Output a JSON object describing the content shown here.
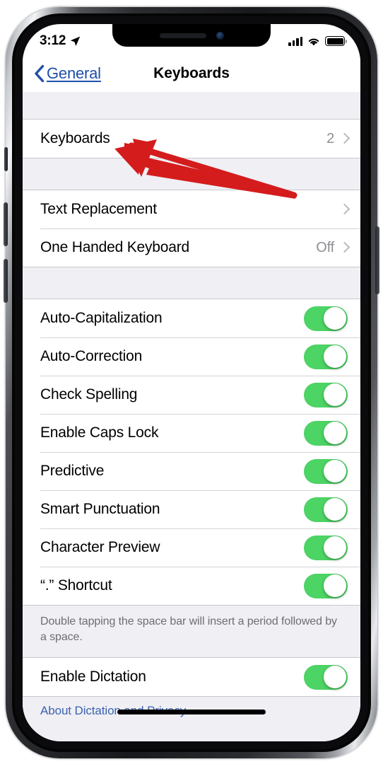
{
  "status_bar": {
    "time": "3:12",
    "location_icon": "location-arrow-icon",
    "signal_icon": "cellular-signal-icon",
    "signal_bars": 4,
    "wifi_icon": "wifi-icon",
    "battery_icon": "battery-full-icon"
  },
  "nav": {
    "back_label": "General",
    "back_icon": "chevron-left-icon",
    "title": "Keyboards"
  },
  "groups": [
    {
      "rows": [
        {
          "label": "Keyboards",
          "value": "2",
          "type": "disclosure",
          "name": "row-keyboards"
        }
      ]
    },
    {
      "rows": [
        {
          "label": "Text Replacement",
          "value": "",
          "type": "disclosure",
          "name": "row-text-replacement"
        },
        {
          "label": "One Handed Keyboard",
          "value": "Off",
          "type": "disclosure",
          "name": "row-one-handed-keyboard"
        }
      ]
    },
    {
      "rows": [
        {
          "label": "Auto-Capitalization",
          "type": "toggle",
          "state": "on",
          "name": "row-auto-capitalization"
        },
        {
          "label": "Auto-Correction",
          "type": "toggle",
          "state": "on",
          "name": "row-auto-correction"
        },
        {
          "label": "Check Spelling",
          "type": "toggle",
          "state": "on",
          "name": "row-check-spelling"
        },
        {
          "label": "Enable Caps Lock",
          "type": "toggle",
          "state": "on",
          "name": "row-enable-caps-lock"
        },
        {
          "label": "Predictive",
          "type": "toggle",
          "state": "on",
          "name": "row-predictive"
        },
        {
          "label": "Smart Punctuation",
          "type": "toggle",
          "state": "on",
          "name": "row-smart-punctuation"
        },
        {
          "label": "Character Preview",
          "type": "toggle",
          "state": "on",
          "name": "row-character-preview"
        },
        {
          "label": "“.” Shortcut",
          "type": "toggle",
          "state": "on",
          "name": "row-period-shortcut"
        }
      ]
    },
    {
      "rows": [
        {
          "label": "Enable Dictation",
          "type": "toggle",
          "state": "on",
          "name": "row-enable-dictation"
        }
      ]
    }
  ],
  "footer_note": "Double tapping the space bar will insert a period followed by a space.",
  "footer_link": "About Dictation and Privacy…",
  "annotation": {
    "type": "arrow",
    "color": "#d41c1c",
    "points_at": "Keyboards"
  },
  "colors": {
    "link_blue": "#1f4fa8",
    "toggle_green": "#4cd464",
    "group_background": "#ffffff",
    "page_background": "#efeff4",
    "secondary_text": "#8e8e93",
    "annotation_red": "#d41c1c"
  }
}
